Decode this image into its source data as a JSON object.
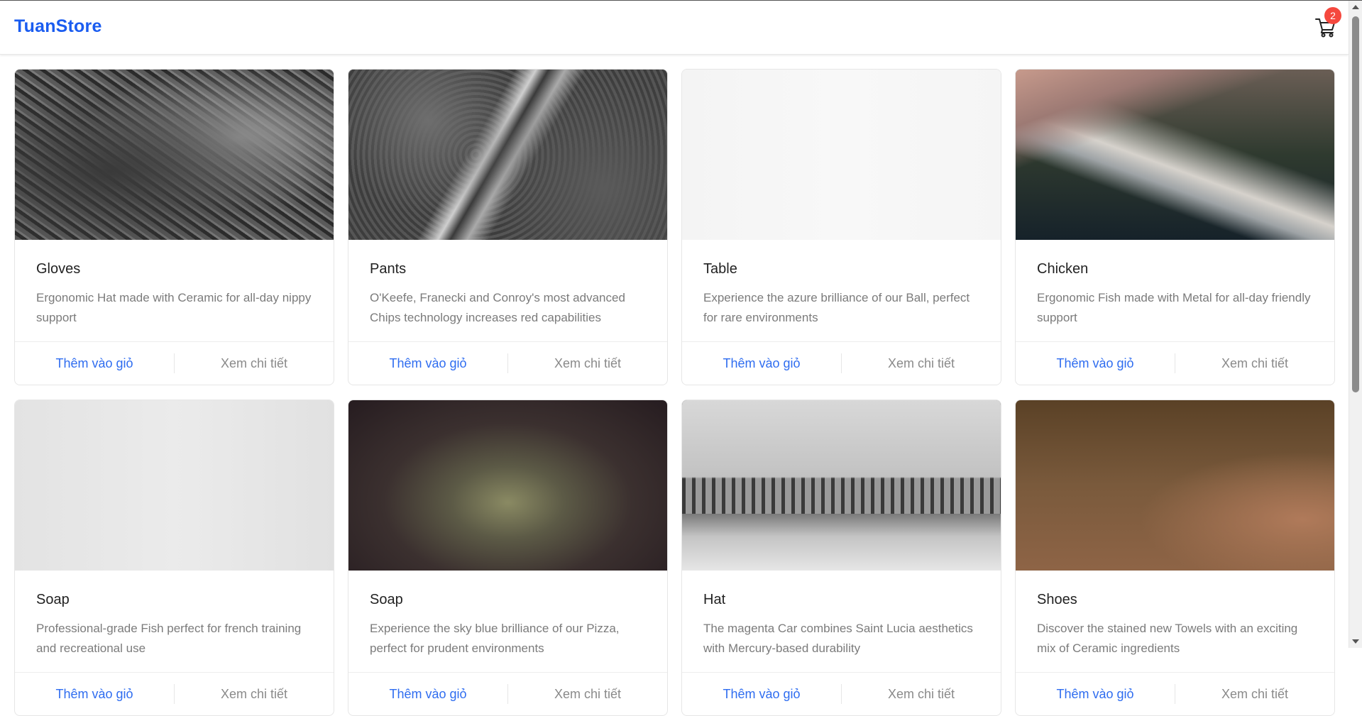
{
  "header": {
    "logo": "TuanStore",
    "cart_count": "2"
  },
  "products": [
    {
      "name": "Gloves",
      "description": "Ergonomic Hat made with Ceramic for all-day nippy support",
      "add_label": "Thêm vào giỏ",
      "detail_label": "Xem chi tiết"
    },
    {
      "name": "Pants",
      "description": "O'Keefe, Franecki and Conroy's most advanced Chips technology increases red capabilities",
      "add_label": "Thêm vào giỏ",
      "detail_label": "Xem chi tiết"
    },
    {
      "name": "Table",
      "description": "Experience the azure brilliance of our Ball, perfect for rare environments",
      "add_label": "Thêm vào giỏ",
      "detail_label": "Xem chi tiết"
    },
    {
      "name": "Chicken",
      "description": "Ergonomic Fish made with Metal for all-day friendly support",
      "add_label": "Thêm vào giỏ",
      "detail_label": "Xem chi tiết"
    },
    {
      "name": "Soap",
      "description": "Professional-grade Fish perfect for french training and recreational use",
      "add_label": "Thêm vào giỏ",
      "detail_label": "Xem chi tiết"
    },
    {
      "name": "Soap",
      "description": "Experience the sky blue brilliance of our Pizza, perfect for prudent environments",
      "add_label": "Thêm vào giỏ",
      "detail_label": "Xem chi tiết"
    },
    {
      "name": "Hat",
      "description": "The magenta Car combines Saint Lucia aesthetics with Mercury-based durability",
      "add_label": "Thêm vào giỏ",
      "detail_label": "Xem chi tiết"
    },
    {
      "name": "Shoes",
      "description": "Discover the stained new Towels with an exciting mix of Ceramic ingredients",
      "add_label": "Thêm vào giỏ",
      "detail_label": "Xem chi tiết"
    }
  ],
  "colors": {
    "brand": "#1a5cf0",
    "badge": "#f5483e",
    "add_link": "#2f6df0"
  }
}
